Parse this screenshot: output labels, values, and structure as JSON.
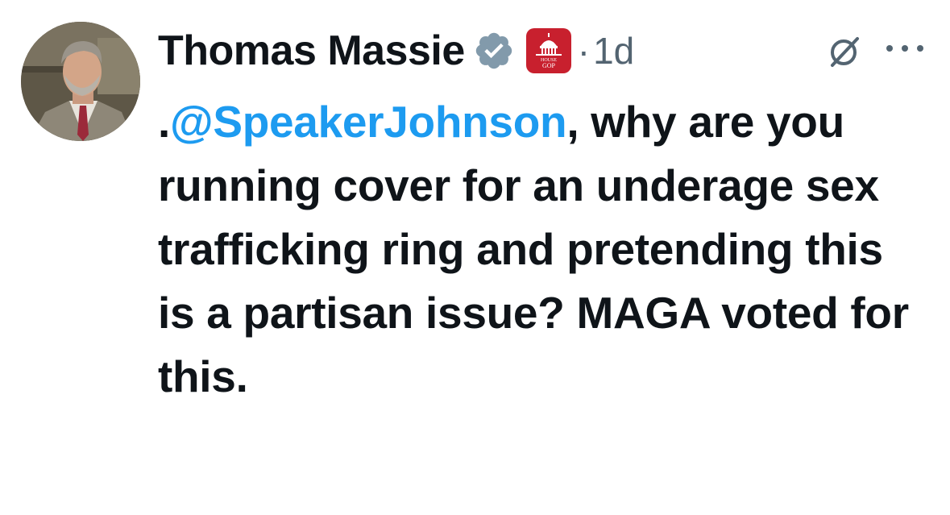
{
  "tweet": {
    "author_name": "Thomas Massie",
    "timestamp": "1d",
    "separator": "·",
    "affiliation_badge_text": [
      "HOUSE",
      "GOP"
    ],
    "text_prefix": ".",
    "mention": "@SpeakerJohnson",
    "text_body": ", why are you running cover for an underage sex trafficking ring and pretending this is a partisan issue? MAGA voted for this."
  },
  "icons": {
    "verified": "verified-badge-icon",
    "affiliation": "house-gop-capitol-icon",
    "grok": "grok-slash-circle-icon",
    "more": "more-options-icon"
  },
  "colors": {
    "text": "#0f1419",
    "secondary": "#536471",
    "mention": "#1d9bf0",
    "verified_badge": "#829aab",
    "affiliation_bg": "#c8202e"
  }
}
